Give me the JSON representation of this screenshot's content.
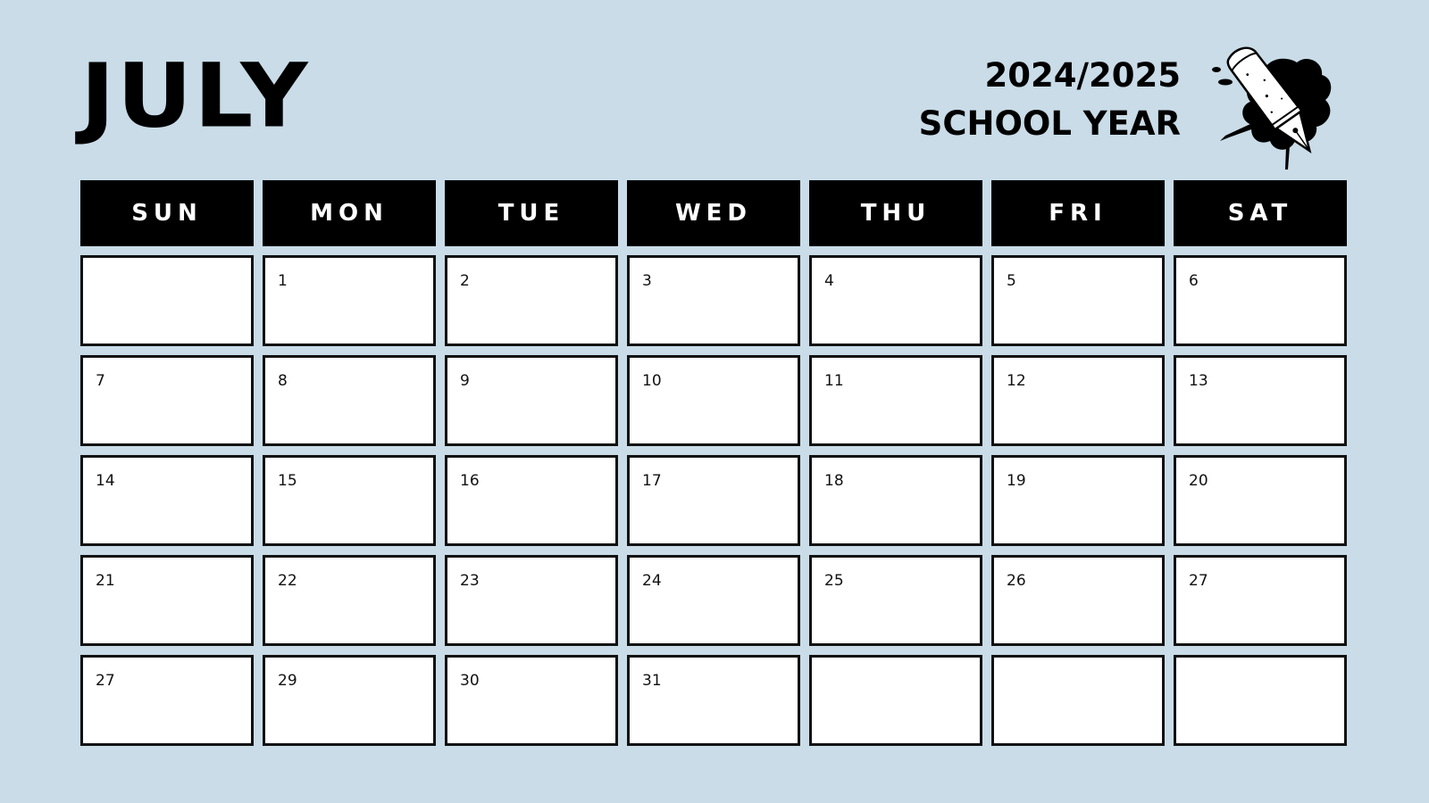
{
  "header": {
    "month": "JULY",
    "year_range": "2024/2025",
    "subtitle": "SCHOOL YEAR",
    "illustration": "fountain-pen-ink-splatter-icon"
  },
  "colors": {
    "background": "#c9dce8",
    "header_cell": "#000000",
    "header_text": "#ffffff",
    "day_cell": "#ffffff",
    "border": "#111111"
  },
  "weekdays": [
    "SUN",
    "MON",
    "TUE",
    "WED",
    "THU",
    "FRI",
    "SAT"
  ],
  "weeks": [
    [
      "",
      "1",
      "2",
      "3",
      "4",
      "5",
      "6"
    ],
    [
      "7",
      "8",
      "9",
      "10",
      "11",
      "12",
      "13"
    ],
    [
      "14",
      "15",
      "16",
      "17",
      "18",
      "19",
      "20"
    ],
    [
      "21",
      "22",
      "23",
      "24",
      "25",
      "26",
      "27"
    ],
    [
      "27",
      "29",
      "30",
      "31",
      "",
      "",
      ""
    ]
  ]
}
